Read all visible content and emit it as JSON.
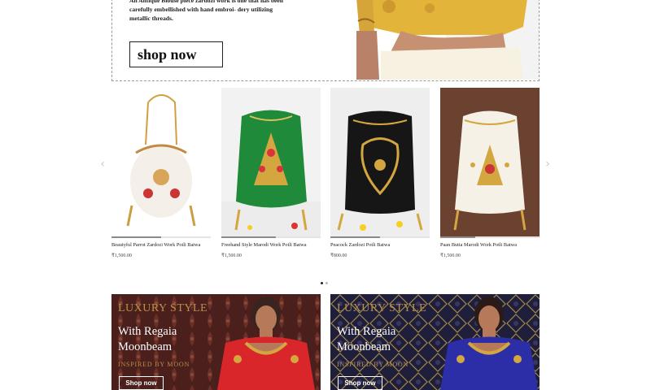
{
  "hero": {
    "description": "An Antique Blouse piece zardozi work is one that has been carefully embellished with hand embroi- dery utilizing metallic threads.",
    "cta_label": "shop now"
  },
  "carousel": {
    "prev_icon": "chevron-left-icon",
    "next_icon": "chevron-right-icon",
    "products": [
      {
        "name": "Beautyful Parrot Zardozi Work Potli Batwa",
        "price": "₹1,500.00",
        "bag_color": "#f4efe8",
        "bg": "#ffffff"
      },
      {
        "name": "Freehand Style Marodi Work Potli Batwa",
        "price": "₹1,500.00",
        "bag_color": "#1f8a3a",
        "bg": "#f2f2f2"
      },
      {
        "name": "Peacock Zardozi Potli Batwa",
        "price": "₹800.00",
        "bag_color": "#161616",
        "bg": "#eeeeee"
      },
      {
        "name": "Paan Butta Marodi Work Potli Batwa",
        "price": "₹1,500.00",
        "bag_color": "#f5f1e6",
        "bg": "#6b4130"
      }
    ],
    "page_dots": 2,
    "active_dot": 0
  },
  "promos": [
    {
      "tag": "LUXURY STYLE",
      "title": "With Regaia Moonbeam",
      "subtitle": "INSPIRED BY MOON",
      "cta_label": "Shop now",
      "bg": "#4a1f1c",
      "blouse": "#d8262a"
    },
    {
      "tag": "LUXURY STYLE",
      "title": "With Regaia Moonbeam",
      "subtitle": "INSPIRED BY MOON",
      "cta_label": "Shop now",
      "bg": "#1f1f3c",
      "blouse": "#2c2ea8"
    }
  ],
  "colors": {
    "gold": "#b9924a",
    "text": "#222222"
  }
}
